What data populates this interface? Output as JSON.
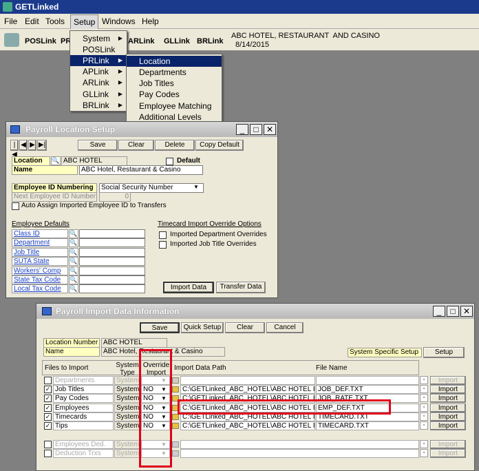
{
  "app": {
    "title": "GETLinked"
  },
  "menubar": [
    "File",
    "Edit",
    "Tools",
    "Setup",
    "Windows",
    "Help"
  ],
  "toolbar": {
    "links": [
      "POSLink",
      "PR",
      "ARLink",
      "GLLink",
      "BRLink"
    ],
    "company": "ABC HOTEL, RESTAURANT  AND CASINO",
    "date": "8/14/2015"
  },
  "setup_menu": [
    "System",
    "POSLink",
    "PRLink",
    "APLink",
    "ARLink",
    "GLLink",
    "BRLink"
  ],
  "prlink_menu": [
    "Location",
    "Departments",
    "Job Titles",
    "Pay Codes",
    "Employee Matching",
    "Additional Levels"
  ],
  "loc": {
    "title": "Payroll Location Setup",
    "nav": [
      "|◀",
      "◀",
      "▶",
      "▶|"
    ],
    "buttons": [
      "Save",
      "Clear",
      "Delete",
      "Copy Default"
    ],
    "location_label": "Location",
    "location_value": "ABC HOTEL",
    "default_label": "Default",
    "name_label": "Name",
    "name_value": "ABC Hotel, Restaurant & Casino",
    "empid_label": "Employee ID Numbering",
    "empid_value": "Social Security Number",
    "next_label": "Next Employee ID Number",
    "next_value": "0",
    "auto_assign": "Auto Assign Imported Employee ID to Transfers",
    "defaults_title": "Employee Defaults",
    "defaults": [
      "Class ID",
      "Department",
      "Job Title",
      "SUTA State",
      "Workers' Comp",
      "State Tax Code",
      "Local Tax Code"
    ],
    "override_title": "Timecard Import Override Options",
    "override_opts": [
      "Imported Department Overrides",
      "Imported Job Title Overrides"
    ],
    "import_btn": "Import Data",
    "transfer_btn": "Transfer Data"
  },
  "imp": {
    "title": "Payroll Import Data Information",
    "buttons": [
      "Save",
      "Quick Setup",
      "Clear",
      "Cancel"
    ],
    "locnum_label": "Location Number",
    "locnum_value": "ABC HOTEL",
    "name_label": "Name",
    "name_value": "ABC Hotel, Restaurant & Casino",
    "sys_specific": "System Specific Setup",
    "setup_btn": "Setup",
    "headers": {
      "files": "Files to Import",
      "systype": "System Type",
      "override": "Override Import",
      "path": "Import Data Path",
      "filename": "File Name"
    },
    "rows": [
      {
        "name": "Departments",
        "type": "System",
        "ovr": "",
        "path": "",
        "file": "",
        "btn": "Import",
        "enabled": false,
        "checked": false
      },
      {
        "name": "Job Titles",
        "type": "System",
        "ovr": "NO",
        "path": "C:\\GETLinked_ABC_HOTEL\\ABC HOTEL I",
        "file": "JOB_DEF.TXT",
        "btn": "Import",
        "enabled": true,
        "checked": true
      },
      {
        "name": "Pay Codes",
        "type": "System",
        "ovr": "NO",
        "path": "C:\\GETLinked_ABC_HOTEL\\ABC HOTEL I",
        "file": "JOB_RATE.TXT",
        "btn": "Import",
        "enabled": true,
        "checked": true
      },
      {
        "name": "Employees",
        "type": "System",
        "ovr": "NO",
        "path": "C:\\GETLinked_ABC_HOTEL\\ABC HOTEL I",
        "file": "EMP_DEF.TXT",
        "btn": "Import",
        "enabled": true,
        "checked": true
      },
      {
        "name": "Timecards",
        "type": "System",
        "ovr": "NO",
        "path": "C:\\GETLinked_ABC_HOTEL\\ABC HOTEL I",
        "file": "TIMECARD.TXT",
        "btn": "Import",
        "enabled": true,
        "checked": true
      },
      {
        "name": "Tips",
        "type": "System",
        "ovr": "NO",
        "path": "C:\\GETLinked_ABC_HOTEL\\ABC HOTEL I",
        "file": "TIMECARD.TXT",
        "btn": "Import",
        "enabled": true,
        "checked": true
      }
    ],
    "rows2": [
      {
        "name": "Employees Ded.",
        "type": "System",
        "btn": "Import"
      },
      {
        "name": "Deduction Trxs",
        "type": "System",
        "btn": "Import"
      }
    ]
  }
}
